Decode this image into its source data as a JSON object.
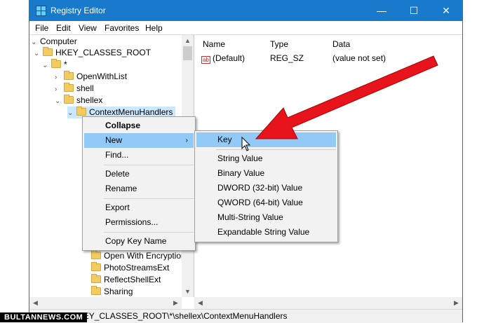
{
  "window": {
    "title": "Registry Editor",
    "minimize": "—",
    "maximize": "☐",
    "close": "✕"
  },
  "menu": [
    "File",
    "Edit",
    "View",
    "Favorites",
    "Help"
  ],
  "tree": {
    "root": "Computer",
    "hkcr": "HKEY_CLASSES_ROOT",
    "star": "*",
    "openwithlist": "OpenWithList",
    "shell": "shell",
    "shellex": "shellex",
    "cmh": "ContextMenuHandlers",
    "lower": [
      "Open With Encryption",
      "PhotoStreamsExt",
      "ReflectShellExt",
      "Sharing"
    ]
  },
  "columns": {
    "name": "Name",
    "type": "Type",
    "data": "Data"
  },
  "value_row": {
    "name": "(Default)",
    "type": "REG_SZ",
    "data": "(value not set)",
    "icon": "ab"
  },
  "context_menu": {
    "collapse": "Collapse",
    "new": "New",
    "find": "Find...",
    "delete": "Delete",
    "rename": "Rename",
    "export": "Export",
    "permissions": "Permissions...",
    "copy_key_name": "Copy Key Name"
  },
  "submenu": [
    "Key",
    "String Value",
    "Binary Value",
    "DWORD (32-bit) Value",
    "QWORD (64-bit) Value",
    "Multi-String Value",
    "Expandable String Value"
  ],
  "status": "Computer\\HKEY_CLASSES_ROOT\\*\\shellex\\ContextMenuHandlers",
  "watermark": "BULTANNEWS.COM",
  "colors": {
    "titlebar": "#1979ca",
    "highlight": "#91c9f7",
    "arrow": "#e8141b"
  }
}
